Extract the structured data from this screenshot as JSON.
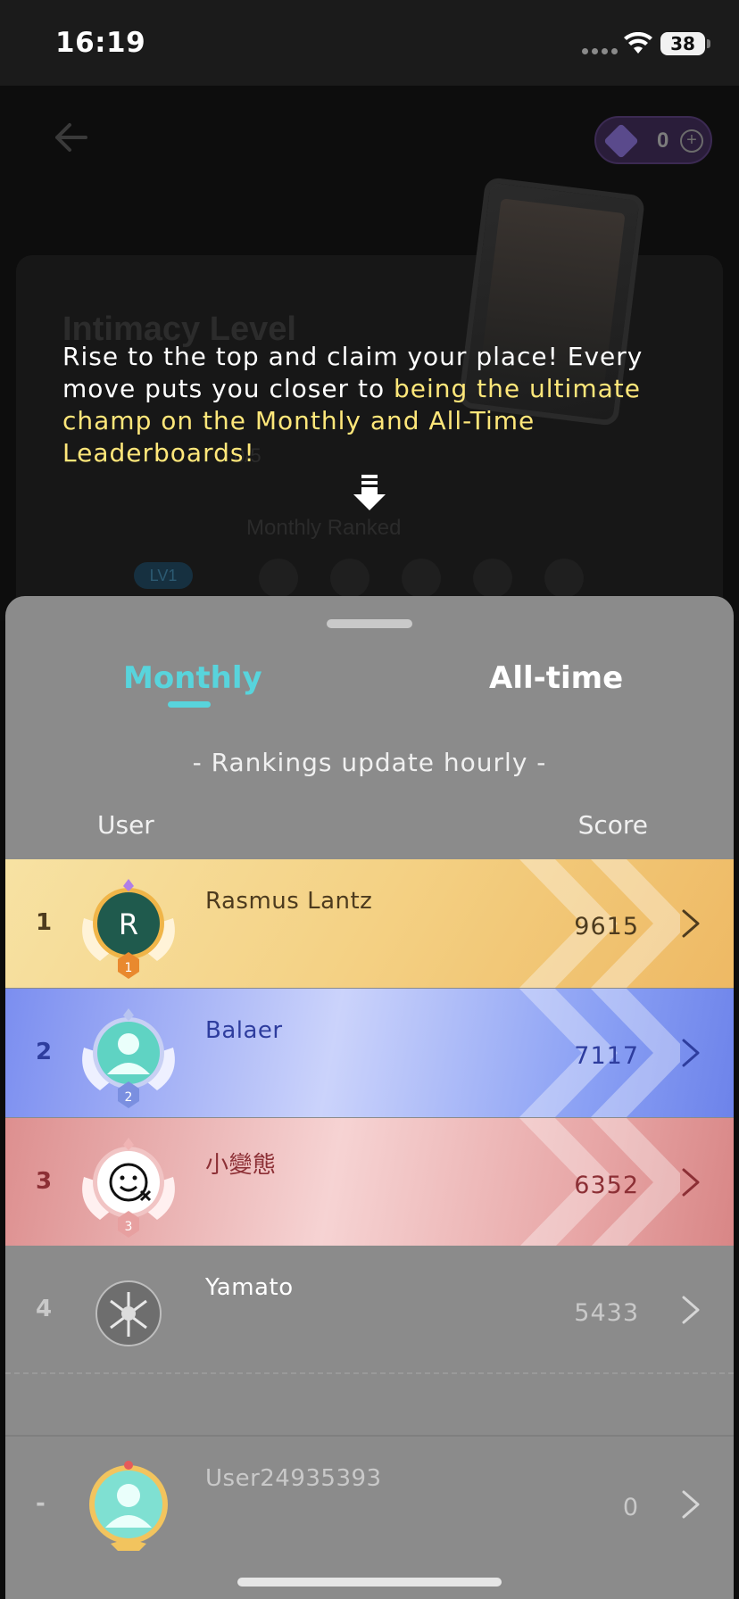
{
  "status_bar": {
    "time": "16:19",
    "battery": "38"
  },
  "background": {
    "gems": "0",
    "title": "Intimacy Level",
    "progress": "0/5",
    "ranked_label": "Monthly Ranked",
    "level_badge": "LV1"
  },
  "tip": {
    "text_plain": "Rise to the top and claim your place! Every move puts you closer to ",
    "text_highlight": "being the ultimate champ on the Monthly and All-Time Leaderboards!"
  },
  "leaderboard": {
    "tabs": [
      {
        "label": "Monthly",
        "active": true
      },
      {
        "label": "All-time",
        "active": false
      }
    ],
    "notice": "- Rankings update hourly -",
    "columns": {
      "user": "User",
      "score": "Score"
    },
    "rows": [
      {
        "rank": "1",
        "name": "Rasmus Lantz",
        "score": "9615",
        "avatar_letter": "R",
        "badge": "1"
      },
      {
        "rank": "2",
        "name": "Balaer",
        "score": "7117",
        "badge": "2"
      },
      {
        "rank": "3",
        "name": "小變態",
        "score": "6352",
        "badge": "3"
      },
      {
        "rank": "4",
        "name": "Yamato",
        "score": "5433"
      }
    ],
    "self_row": {
      "rank": "-",
      "name": "User24935393",
      "score": "0"
    }
  },
  "colors": {
    "accent_teal": "#58d4dc",
    "gold": "#f4d184",
    "silver_blue": "#7b8ef0",
    "bronze_red": "#dd8f8f",
    "sheet_gray": "#8b8b8b"
  },
  "icons": [
    "back-arrow-icon",
    "gem-icon",
    "plus-icon",
    "down-arrow-icon",
    "chevron-right-icon",
    "wifi-icon",
    "battery-icon"
  ]
}
